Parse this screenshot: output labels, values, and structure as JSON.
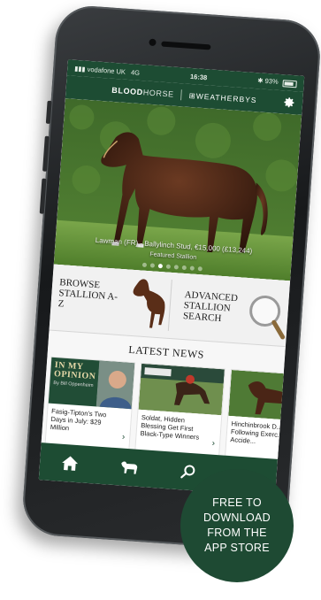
{
  "status": {
    "carrier": "vodafone UK",
    "network": "4G",
    "time": "16:38",
    "battery": "93%"
  },
  "header": {
    "logo_part1": "BLOOD",
    "logo_part2": "HORSE",
    "partner_logo": "WEATHERBYS",
    "settings_icon": "gear-icon"
  },
  "hero": {
    "caption": "Lawman (FR) - Ballylinch Stud, €15,000 (£13,244)",
    "subcaption": "Featured Stallion",
    "slides_total": 8,
    "active_slide": 3
  },
  "tools": {
    "browse_label": "BROWSE STALLION A-Z",
    "advanced_label": "ADVANCED STALLION SEARCH"
  },
  "news": {
    "section_title": "LATEST NEWS",
    "cards": [
      {
        "thumb_text": "IN MY OPINION",
        "thumb_byline": "By Bill Oppenheim",
        "headline": "Fasig-Tipton's Two Days in July: $29 Million"
      },
      {
        "thumb_text": "",
        "thumb_byline": "",
        "headline": "Soldat, Hidden Blessing Get First Black-Type Winners"
      },
      {
        "thumb_text": "",
        "thumb_byline": "",
        "headline": "Hinchinbrook D... Following Exerc... Accide..."
      }
    ]
  },
  "nav": {
    "items": [
      "home-icon",
      "horse-icon",
      "search-icon"
    ]
  },
  "promo": {
    "line1": "FREE TO",
    "line2": "DOWNLOAD",
    "line3": "FROM THE",
    "line4": "APP STORE"
  },
  "colors": {
    "brand_green": "#1d4c33",
    "promo_green": "#1e4a33"
  }
}
